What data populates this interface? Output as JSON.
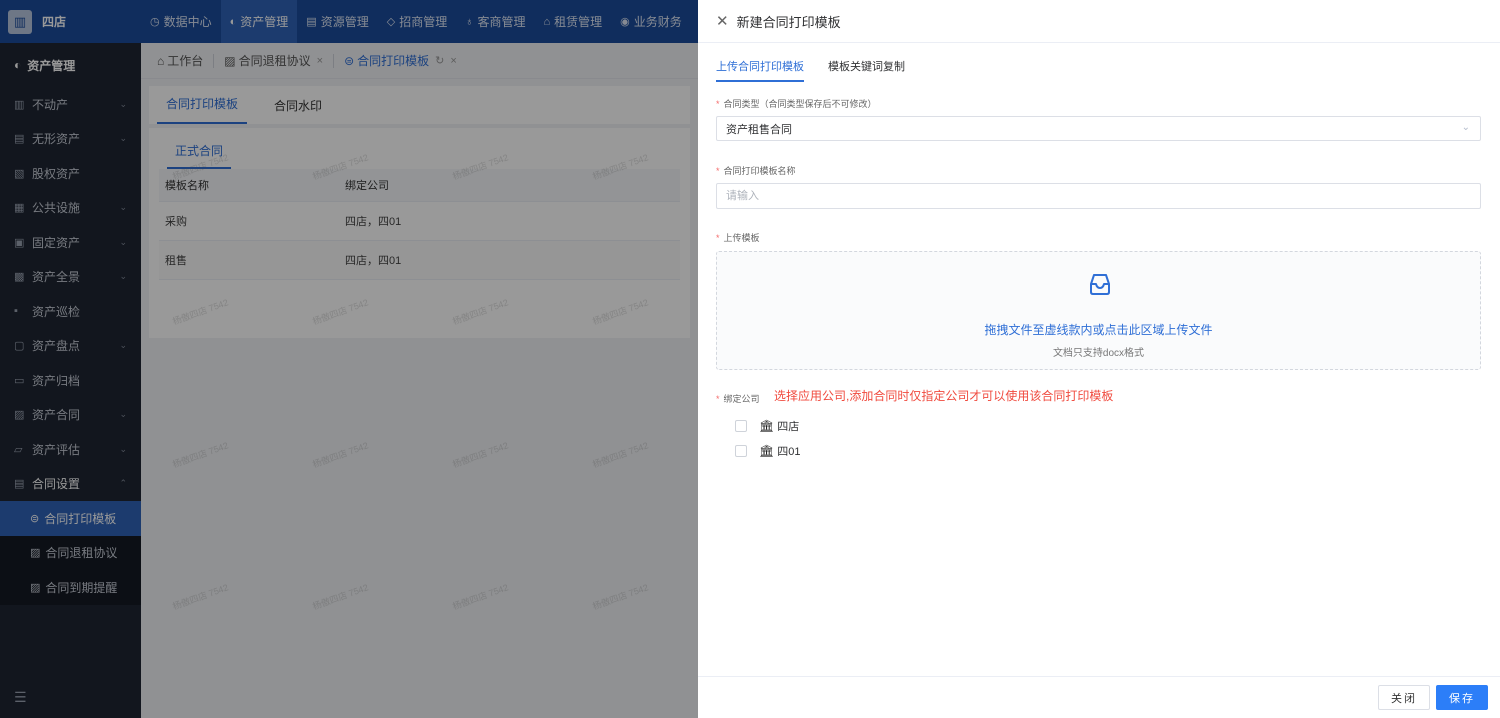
{
  "brand": {
    "name": "四店",
    "logo_icon": "building-icon"
  },
  "topnav": [
    {
      "label": "数据中心",
      "icon": "◷"
    },
    {
      "label": "资产管理",
      "icon": "◐",
      "active": true
    },
    {
      "label": "资源管理",
      "icon": "▤"
    },
    {
      "label": "招商管理",
      "icon": "◇"
    },
    {
      "label": "客商管理",
      "icon": "♁"
    },
    {
      "label": "租赁管理",
      "icon": "⌂"
    },
    {
      "label": "业务财务",
      "icon": "◉"
    }
  ],
  "sidebar": {
    "header": "资产管理",
    "items": [
      {
        "label": "不动产",
        "icon": "▥",
        "chev": "⌄"
      },
      {
        "label": "无形资产",
        "icon": "▤",
        "chev": "⌄"
      },
      {
        "label": "股权资产",
        "icon": "▧",
        "chev": ""
      },
      {
        "label": "公共设施",
        "icon": "▦",
        "chev": "⌄"
      },
      {
        "label": "固定资产",
        "icon": "▣",
        "chev": "⌄"
      },
      {
        "label": "资产全景",
        "icon": "▩",
        "chev": "⌄"
      },
      {
        "label": "资产巡检",
        "icon": "▪",
        "chev": ""
      },
      {
        "label": "资产盘点",
        "icon": "▢",
        "chev": "⌄"
      },
      {
        "label": "资产归档",
        "icon": "▭",
        "chev": ""
      },
      {
        "label": "资产合同",
        "icon": "▨",
        "chev": "⌄"
      },
      {
        "label": "资产评估",
        "icon": "▱",
        "chev": "⌄"
      },
      {
        "label": "合同设置",
        "icon": "▤",
        "chev": "⌃"
      }
    ],
    "subitems": [
      {
        "label": "合同打印模板",
        "icon": "⊜"
      },
      {
        "label": "合同退租协议",
        "icon": "▨"
      },
      {
        "label": "合同到期提醒",
        "icon": "▨"
      }
    ]
  },
  "tabs": [
    {
      "label": "工作台",
      "icon": "⌂"
    },
    {
      "label": "合同退租协议",
      "icon": "▨",
      "close": "×"
    },
    {
      "label": "合同打印模板",
      "icon": "⊜",
      "refresh": "↻",
      "close": "×"
    }
  ],
  "main": {
    "subtabs": [
      "合同打印模板",
      "合同水印"
    ],
    "card_tab": "正式合同",
    "columns": [
      "模板名称",
      "绑定公司"
    ],
    "rows": [
      [
        "采购",
        "四店，四01"
      ],
      [
        "租售",
        "四店，四01"
      ]
    ],
    "watermark": "杨傲四店 7542"
  },
  "drawer": {
    "title": "新建合同打印模板",
    "tabs": [
      "上传合同打印模板",
      "模板关键词复制"
    ],
    "contract_type_label": "合同类型（合同类型保存后不可修改）",
    "contract_type_value": "资产租售合同",
    "name_label": "合同打印模板名称",
    "name_placeholder": "请输入",
    "upload_label": "上传模板",
    "upload_text": "拖拽文件至虚线款内或点击此区域上传文件",
    "upload_tip": "文档只支持docx格式",
    "bind_label": "绑定公司",
    "bind_hint": "选择应用公司,添加合同时仅指定公司才可以使用该合同打印模板",
    "companies": [
      "四店",
      "四01"
    ],
    "close_btn": "关闭",
    "save_btn": "保存"
  },
  "colors": {
    "primary": "#2f6fd6",
    "topbar": "#1b4b9b",
    "sidebar": "#1f2633",
    "required": "#f56c6c",
    "hint": "#f04a3e"
  }
}
